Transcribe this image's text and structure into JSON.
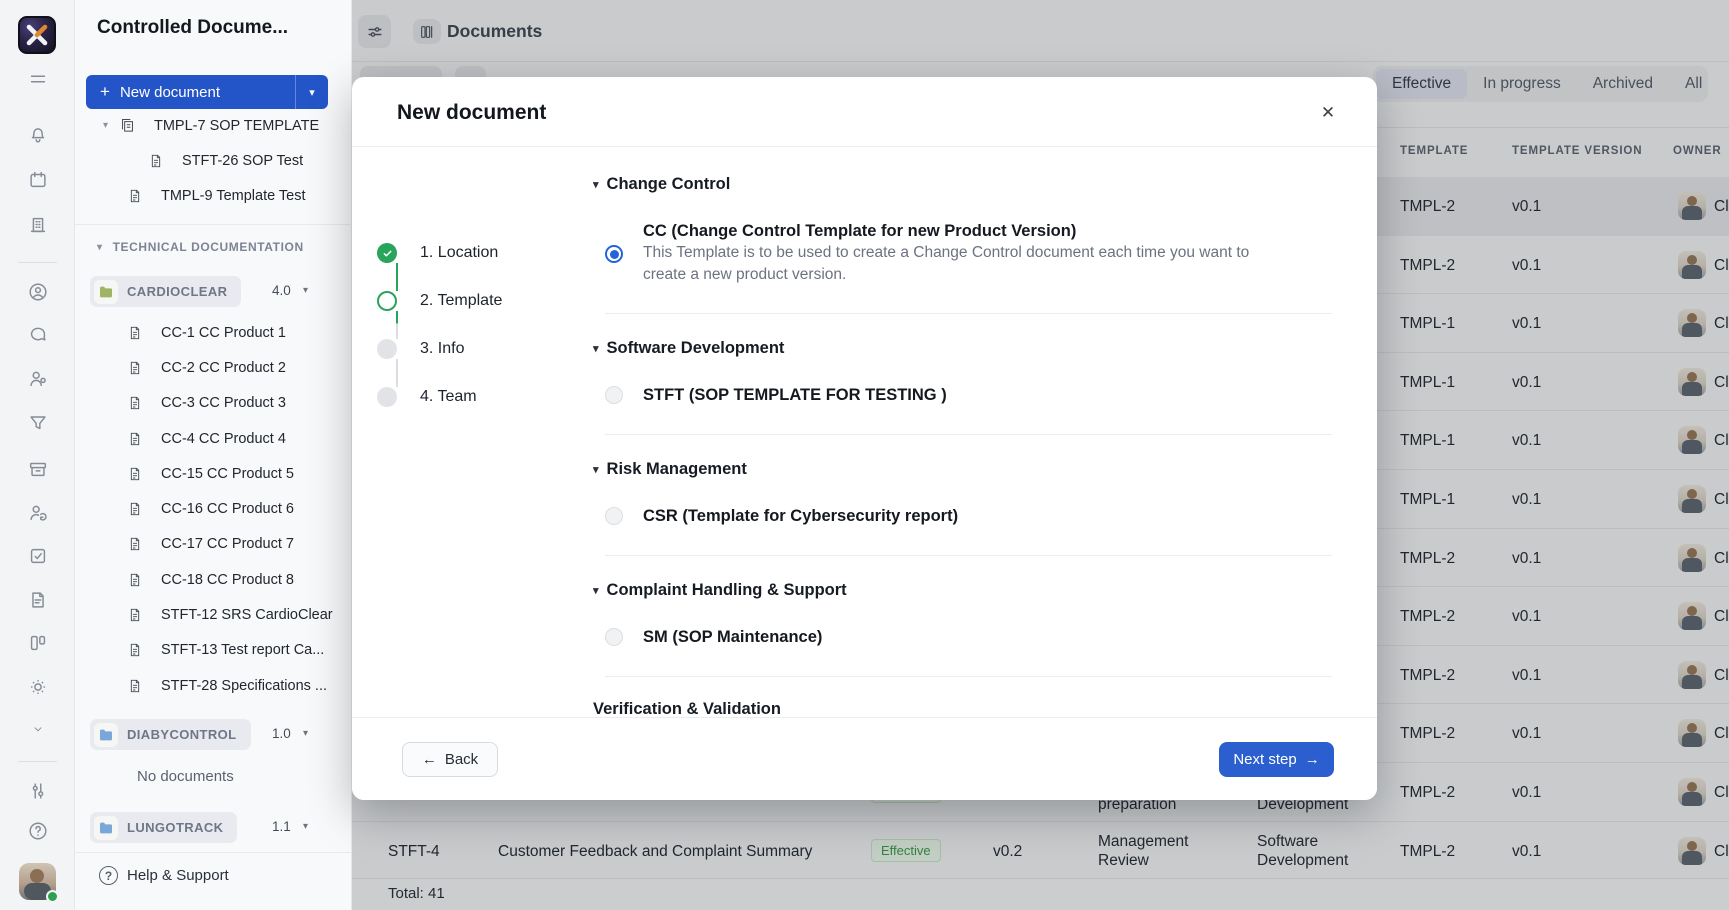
{
  "app": {
    "sidebar_title": "Controlled Docume...",
    "logo_letter": "X"
  },
  "rail": {
    "icons": [
      "menu-icon",
      "bell-icon",
      "calendar-icon",
      "building-icon",
      "user-circle-icon",
      "chat-icon",
      "people-icon",
      "filter-icon",
      "archive-icon",
      "person-sync-icon",
      "task-check-icon",
      "file-icon",
      "kanban-icon",
      "brightness-icon",
      "chevron-down-icon",
      "sliders-icon",
      "help-icon",
      "user-avatar"
    ]
  },
  "sidebar": {
    "new_document_label": "New document",
    "tree": [
      {
        "label": "TMPL-7 SOP TEMPLATE",
        "icon": "template-icon",
        "indent": 0,
        "caret": true
      },
      {
        "label": "STFT-26 SOP Test",
        "icon": "document-icon",
        "indent": 2,
        "caret": false
      },
      {
        "label": "TMPL-9 Template Test",
        "icon": "document-icon",
        "indent": 1,
        "caret": false
      }
    ],
    "section_label": "TECHNICAL DOCUMENTATION",
    "folders": [
      {
        "name": "CARDIOCLEAR",
        "version": "4.0",
        "color": "#a0b465",
        "docs": [
          "CC-1 CC Product 1",
          "CC-2 CC Product 2",
          "CC-3 CC Product 3",
          "CC-4 CC Product 4",
          "CC-15 CC Product 5",
          "CC-16 CC Product 6",
          "CC-17 CC Product 7",
          "CC-18 CC Product 8",
          "STFT-12 SRS CardioClear",
          "STFT-13 Test report Ca...",
          "STFT-28 Specifications ..."
        ]
      },
      {
        "name": "DIABYCONTROL",
        "version": "1.0",
        "color": "#7aa7d9",
        "empty_label": "No documents",
        "docs": []
      },
      {
        "name": "LUNGOTRACK",
        "version": "1.1",
        "color": "#7aa7d9",
        "docs": []
      }
    ],
    "help_label": "Help & Support"
  },
  "topbar": {
    "title": "Documents"
  },
  "filters": {
    "tabs": [
      "Effective",
      "In progress",
      "Archived",
      "All"
    ],
    "selected": "Effective"
  },
  "table": {
    "headers": [
      "TEMPLATE",
      "TEMPLATE VERSION",
      "OWNER"
    ],
    "rows": [
      {
        "template": "TMPL-2",
        "template_version": "v0.1",
        "owner": "Cl",
        "selected": true
      },
      {
        "template": "TMPL-2",
        "template_version": "v0.1",
        "owner": "Cl"
      },
      {
        "template": "TMPL-1",
        "template_version": "v0.1",
        "owner": "Cl"
      },
      {
        "template": "TMPL-1",
        "template_version": "v0.1",
        "owner": "Cl"
      },
      {
        "template": "TMPL-1",
        "template_version": "v0.1",
        "owner": "Cl"
      },
      {
        "template": "TMPL-1",
        "template_version": "v0.1",
        "owner": "Cl"
      },
      {
        "template": "TMPL-2",
        "template_version": "v0.1",
        "owner": "Cl"
      },
      {
        "template": "TMPL-2",
        "template_version": "v0.1",
        "owner": "Cl"
      },
      {
        "template": "TMPL-2",
        "template_version": "v0.1",
        "owner": "Cl"
      },
      {
        "template": "TMPL-2",
        "template_version": "v0.1",
        "owner": "Cl"
      },
      {
        "template": "TMPL-2",
        "template_version": "v0.1",
        "owner": "Cl",
        "status": "Effective",
        "process_partial": "preparation",
        "category_partial": "Development"
      },
      {
        "id": "STFT-4",
        "name": "Customer Feedback and Complaint Summary",
        "status": "Effective",
        "version": "v0.2",
        "process": [
          "Management",
          "Review"
        ],
        "category": [
          "Software",
          "Development"
        ],
        "template": "TMPL-2",
        "template_version": "v0.1",
        "owner": "Cl"
      }
    ],
    "total_label": "Total: 41"
  },
  "modal": {
    "title": "New document",
    "close_icon": "✕",
    "steps": [
      {
        "label": "1. Location",
        "state": "done"
      },
      {
        "label": "2. Template",
        "state": "current"
      },
      {
        "label": "3. Info",
        "state": "todo"
      },
      {
        "label": "4. Team",
        "state": "todo"
      }
    ],
    "sections": [
      {
        "title": "Change Control",
        "options": [
          {
            "name": "CC (Change Control Template for new Product Version)",
            "description": "This Template is to be used to create a Change Control document each time you want to create a new product version.",
            "selected": true
          }
        ]
      },
      {
        "title": "Software Development",
        "options": [
          {
            "name": "STFT (SOP TEMPLATE FOR TESTING )",
            "selected": false
          }
        ]
      },
      {
        "title": "Risk Management",
        "options": [
          {
            "name": "CSR (Template for Cybersecurity report)",
            "selected": false
          }
        ]
      },
      {
        "title": "Complaint Handling & Support",
        "options": [
          {
            "name": "SM (SOP Maintenance)",
            "selected": false
          }
        ]
      }
    ],
    "partial_section_title": "Verification & Validation",
    "back_label": "Back",
    "next_label": "Next step"
  },
  "colors": {
    "primary_blue": "#2b5fd0",
    "sidebar_button_blue": "#2355c8",
    "step_green": "#28a45b",
    "badge_green": "#3d9a46",
    "radio_blue": "#2563d8"
  }
}
